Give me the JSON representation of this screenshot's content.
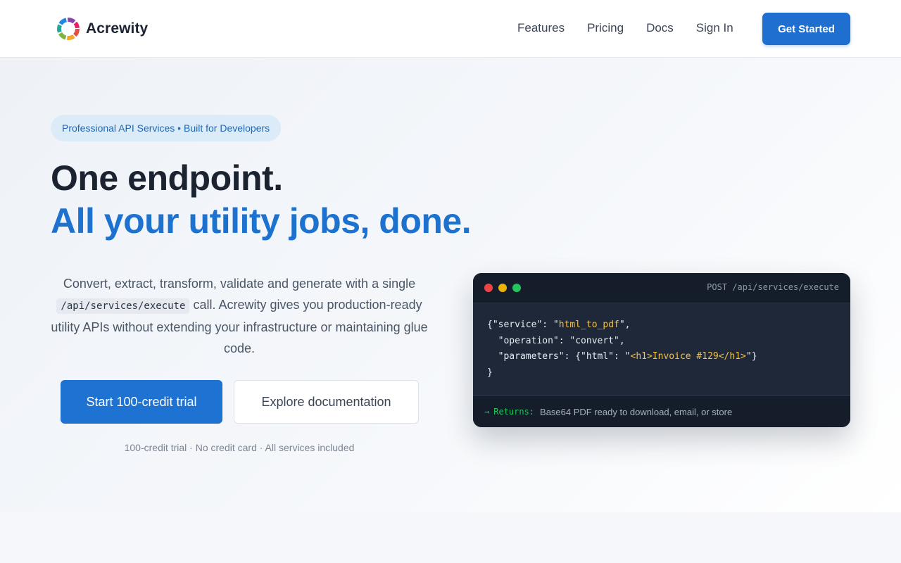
{
  "brand": {
    "name": "Acrewity",
    "logo_icon": "circular-logo-icon"
  },
  "nav": {
    "items": [
      "Features",
      "Pricing",
      "Docs",
      "Sign In"
    ],
    "cta": "Get Started"
  },
  "hero": {
    "pill": "Professional API Services • Built for Developers",
    "headline_line1": "One endpoint.",
    "headline_line2": "All your utility jobs, done.",
    "desc_before": "Convert, extract, transform, validate and generate with a single",
    "desc_code": "/api/services/execute",
    "desc_after": "call. Acrewity gives you production-ready utility APIs without extending your infrastructure or maintaining glue code.",
    "primary_button": "Start 100-credit trial",
    "secondary_button": "Explore documentation",
    "note": "100-credit trial · No credit card · All services included"
  },
  "code_card": {
    "path": "POST /api/services/execute",
    "line1_a": "{\"service\": \"",
    "line1_s": "html_to_pdf",
    "line1_b": "\",",
    "line2": "  \"operation\": \"convert\",",
    "line3_a": "  \"parameters\": {\"html\": \"",
    "line3_s": "<h1>Invoice #129</h1>",
    "line3_b": "\"}",
    "line4": "}",
    "arrow": "→",
    "returns_label": "Returns:",
    "returns_text": "Base64 PDF ready to download, email, or store"
  },
  "colors": {
    "accent": "#1e72d2",
    "headline_blue": "#1e72cf",
    "code_bg": "#1e2838",
    "code_string": "#f2c14e",
    "returns_green": "#22c55e"
  }
}
